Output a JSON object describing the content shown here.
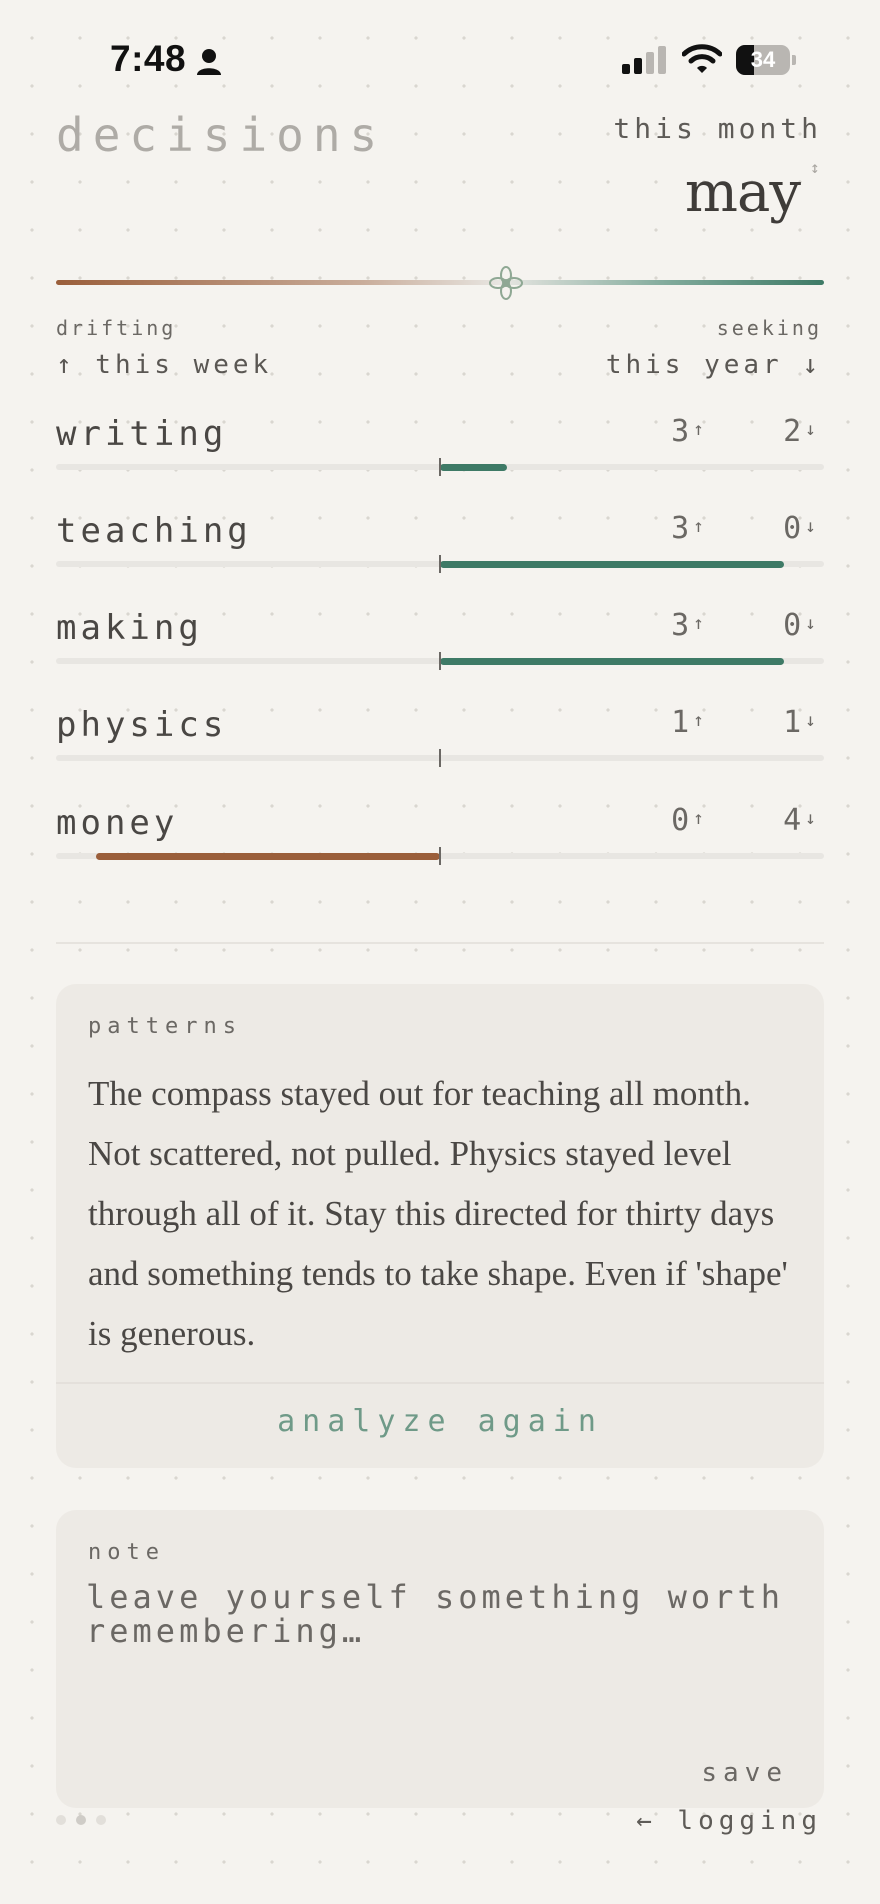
{
  "status_bar": {
    "time": "7:48",
    "battery": "34",
    "battery_level": 0.34
  },
  "header": {
    "title": "decisions",
    "period": "this month",
    "month": "may",
    "toggle_icon": "up-down-arrow-icon"
  },
  "compass": {
    "left_label": "drifting",
    "right_label": "seeking",
    "left_sub": "↑ this week",
    "right_sub": "this year ↓",
    "colors": {
      "drifting": "#9a5e3a",
      "seeking": "#3e7a66"
    }
  },
  "categories": [
    {
      "name": "writing",
      "up": "3",
      "down": "2",
      "score": 0.18,
      "color": "#3e7a66"
    },
    {
      "name": "teaching",
      "up": "3",
      "down": "0",
      "score": 0.92,
      "color": "#3e7a66"
    },
    {
      "name": "making",
      "up": "3",
      "down": "0",
      "score": 0.92,
      "color": "#3e7a66"
    },
    {
      "name": "physics",
      "up": "1",
      "down": "1",
      "score": 0,
      "color": "#3e7a66"
    },
    {
      "name": "money",
      "up": "0",
      "down": "4",
      "score": -0.92,
      "color": "#9a5e3a"
    }
  ],
  "up_arrow": "↑",
  "down_arrow": "↓",
  "patterns": {
    "label": "patterns",
    "text": "The compass stayed out for teaching all month. Not scattered, not pulled. Physics stayed level through all of it. Stay this directed for thirty days and something tends to take shape. Even if 'shape' is generous.",
    "action": "analyze again"
  },
  "note": {
    "label": "note",
    "placeholder": "leave yourself something worth remembering…",
    "save": "save"
  },
  "footer": {
    "nav": "← logging",
    "page_count": 3,
    "active_page": 1
  }
}
